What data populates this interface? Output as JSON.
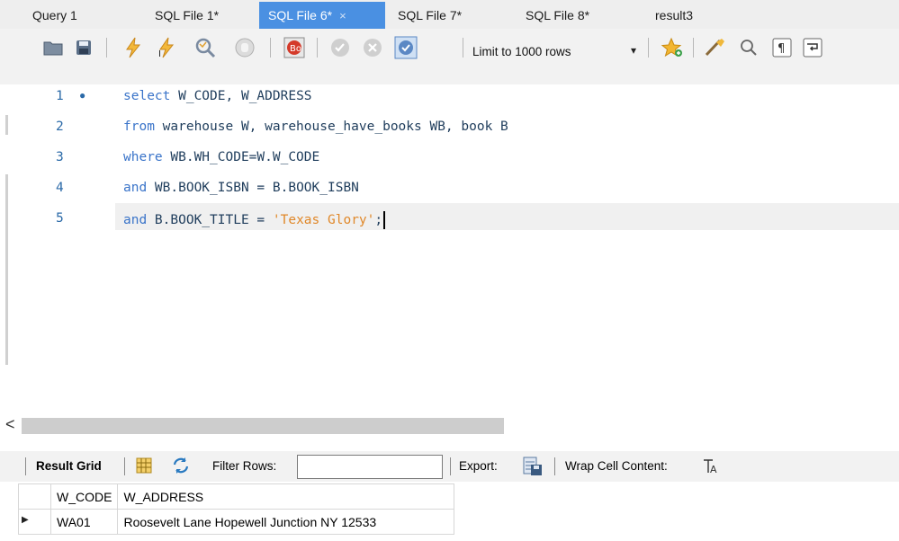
{
  "tabs": [
    {
      "label": "Query 1",
      "active": false
    },
    {
      "label": "SQL File 1*",
      "active": false
    },
    {
      "label": "SQL File 6*",
      "active": true,
      "close": "×"
    },
    {
      "label": "SQL File 7*",
      "active": false
    },
    {
      "label": "SQL File 8*",
      "active": false
    },
    {
      "label": "result3",
      "active": false
    }
  ],
  "toolbar": {
    "limit_label": "Limit to 1000 rows",
    "icons": [
      "open-folder-icon",
      "save-icon",
      "execute-icon",
      "execute-current-icon",
      "explain-icon",
      "stop-icon",
      "toggle-stop-on-error-icon",
      "commit-icon",
      "rollback-icon",
      "autocommit-icon",
      "beautify-icon",
      "find-icon",
      "invisible-chars-icon",
      "word-wrap-icon",
      "bookmark-star-icon"
    ]
  },
  "editor": {
    "lines": [
      {
        "num": "1",
        "marker": "●"
      },
      {
        "num": "2"
      },
      {
        "num": "3"
      },
      {
        "num": "4"
      },
      {
        "num": "5"
      }
    ],
    "code": {
      "l1_kw": "select",
      "l1_rest": " W_CODE, W_ADDRESS",
      "l2_kw": "from",
      "l2_rest": " warehouse W, warehouse_have_books WB, book B",
      "l3_kw": "where",
      "l3_rest": " WB.WH_CODE=W.W_CODE",
      "l4_kw": "and",
      "l4_rest": " WB.BOOK_ISBN = B.BOOK_ISBN",
      "l5_kw": "and",
      "l5_rest": " B.BOOK_TITLE = ",
      "l5_str": "'Texas Glory'",
      "l5_end": ";"
    }
  },
  "scroll": {
    "left_arrow": "<"
  },
  "result_toolbar": {
    "result_grid": "Result Grid",
    "filter_rows": "Filter Rows:",
    "filter_value": "",
    "export": "Export:",
    "wrap": "Wrap Cell Content:"
  },
  "grid": {
    "columns": [
      "W_CODE",
      "W_ADDRESS"
    ],
    "rows": [
      {
        "indicator": "▶",
        "cells": [
          "WA01",
          "Roosevelt Lane Hopewell Junction NY 12533"
        ]
      }
    ]
  }
}
